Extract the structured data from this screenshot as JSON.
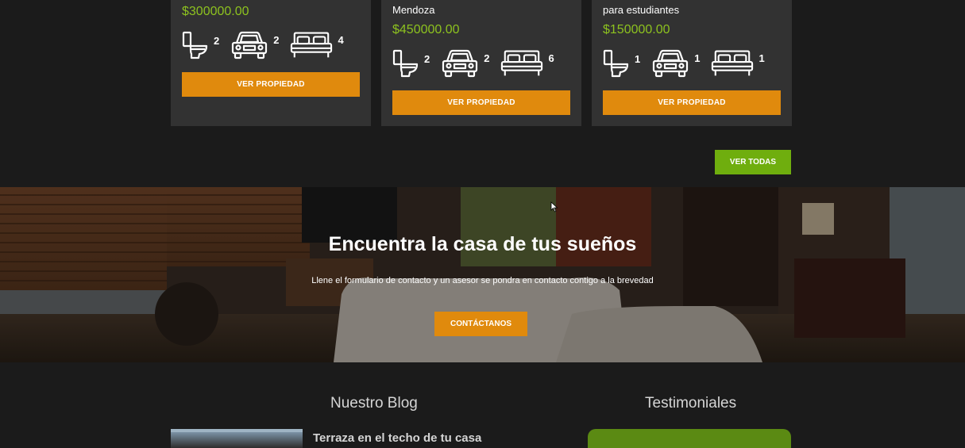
{
  "colors": {
    "accent_orange": "#e08a0d",
    "accent_green": "#6fae0e",
    "price_green": "#8dc21f",
    "card_bg": "#323232",
    "page_bg": "#1b1b1b"
  },
  "cards": [
    {
      "subtitle": "",
      "price": "$300000.00",
      "baths": "2",
      "parking": "2",
      "bedrooms": "4",
      "button": "VER PROPIEDAD"
    },
    {
      "subtitle": "Mendoza",
      "price": "$450000.00",
      "baths": "2",
      "parking": "2",
      "bedrooms": "6",
      "button": "VER PROPIEDAD"
    },
    {
      "subtitle": "para estudiantes",
      "price": "$150000.00",
      "baths": "1",
      "parking": "1",
      "bedrooms": "1",
      "button": "VER PROPIEDAD"
    }
  ],
  "see_all_button": "VER TODAS",
  "hero": {
    "title": "Encuentra la casa de tus sueños",
    "text": "Llene el formulario de contacto y un asesor se pondra en contacto contigo a la brevedad",
    "button": "CONTÁCTANOS"
  },
  "blog": {
    "title": "Nuestro Blog",
    "post_title": "Terraza en el techo de tu casa"
  },
  "testimonials": {
    "title": "Testimoniales"
  },
  "icons": {
    "bath": "toilet-icon",
    "parking": "car-icon",
    "bedrooms": "bed-icon"
  }
}
